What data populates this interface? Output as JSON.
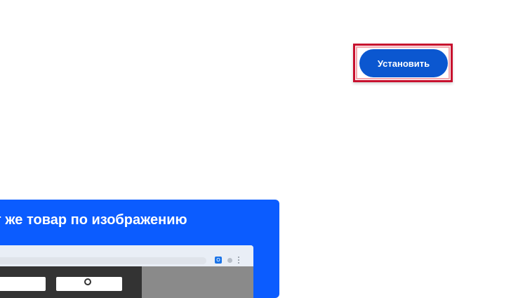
{
  "install": {
    "label": "Установить"
  },
  "promo": {
    "title": "т же товар по изображению"
  },
  "mock_browser": {
    "extension_icon_letter": "O"
  },
  "colors": {
    "install_button": "#0b57d0",
    "highlight_frame": "#c8102e",
    "promo_background": "#0b5cff"
  }
}
